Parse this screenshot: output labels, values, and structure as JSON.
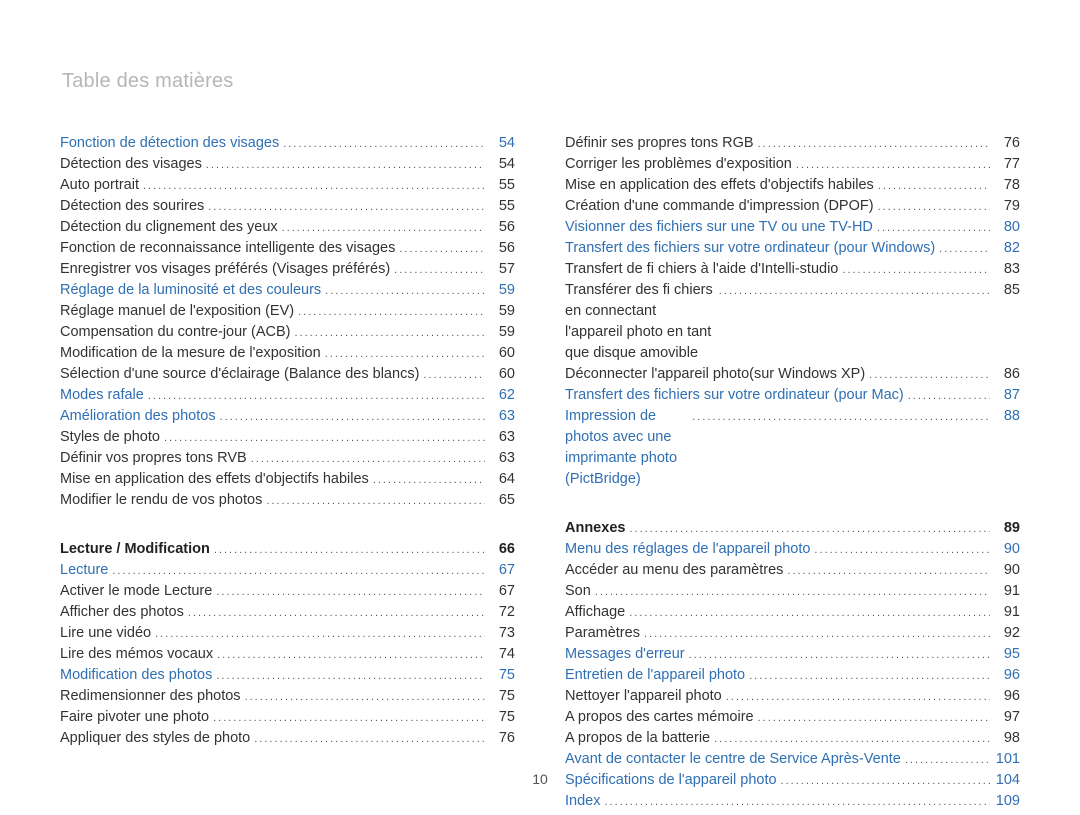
{
  "header": {
    "title": "Table des matières"
  },
  "page_number": "10",
  "columns": [
    [
      {
        "label": "Fonction de détection des visages",
        "page": "54",
        "style": "highlight"
      },
      {
        "label": "Détection des visages",
        "page": "54"
      },
      {
        "label": "Auto portrait",
        "page": "55"
      },
      {
        "label": "Détection des sourires",
        "page": "55"
      },
      {
        "label": "Détection du clignement des yeux",
        "page": "56"
      },
      {
        "label": "Fonction de reconnaissance intelligente des visages",
        "page": "56"
      },
      {
        "label": "Enregistrer vos visages préférés (Visages préférés)",
        "page": "57"
      },
      {
        "label": "Réglage de la luminosité et des couleurs",
        "page": "59",
        "style": "highlight"
      },
      {
        "label": "Réglage manuel de l'exposition (EV)",
        "page": "59"
      },
      {
        "label": "Compensation du contre-jour (ACB)",
        "page": "59"
      },
      {
        "label": "Modification de la mesure de l'exposition",
        "page": "60"
      },
      {
        "label": "Sélection d'une source d'éclairage (Balance des blancs)",
        "page": "60"
      },
      {
        "label": "Modes rafale",
        "page": "62",
        "style": "highlight"
      },
      {
        "label": "Amélioration des photos",
        "page": "63",
        "style": "highlight"
      },
      {
        "label": "Styles de photo",
        "page": "63"
      },
      {
        "label": "Définir vos propres tons RVB",
        "page": "63"
      },
      {
        "label": "Mise en application des effets d'objectifs habiles",
        "page": "64"
      },
      {
        "label": "Modifier le rendu de vos photos",
        "page": "65"
      },
      {
        "label": "Lecture / Modification",
        "page": "66",
        "style": "chapter",
        "gap": true
      },
      {
        "label": "Lecture",
        "page": "67",
        "style": "highlight"
      },
      {
        "label": "Activer le mode Lecture",
        "page": "67"
      },
      {
        "label": "Afficher des photos",
        "page": "72"
      },
      {
        "label": "Lire une vidéo",
        "page": "73"
      },
      {
        "label": "Lire des mémos vocaux",
        "page": "74"
      },
      {
        "label": "Modification des photos",
        "page": "75",
        "style": "highlight"
      },
      {
        "label": "Redimensionner des photos",
        "page": "75"
      },
      {
        "label": "Faire pivoter une photo",
        "page": "75"
      },
      {
        "label": "Appliquer des styles de photo",
        "page": "76"
      }
    ],
    [
      {
        "label": "Définir ses propres tons RGB",
        "page": "76"
      },
      {
        "label": "Corriger les problèmes d'exposition",
        "page": "77"
      },
      {
        "label": "Mise en application des effets d'objectifs habiles",
        "page": "78"
      },
      {
        "label": "Création d'une commande d'impression (DPOF)",
        "page": "79"
      },
      {
        "label": "Visionner des fichiers sur une TV ou une TV-HD",
        "page": "80",
        "style": "highlight"
      },
      {
        "label": "Transfert des fichiers sur votre ordinateur (pour Windows)",
        "page": "82",
        "style": "highlight"
      },
      {
        "label": "Transfert de fi chiers à l'aide d'Intelli-studio",
        "page": "83"
      },
      {
        "label": "Transférer des fi chiers en connectant l'appareil photo en tant que disque amovible",
        "page": "85",
        "wrap": true
      },
      {
        "label": "Déconnecter l'appareil photo(sur Windows XP)",
        "page": "86"
      },
      {
        "label": "Transfert des fichiers sur votre ordinateur (pour Mac)",
        "page": "87",
        "style": "highlight"
      },
      {
        "label": "Impression de photos avec une imprimante photo (PictBridge)",
        "page": "88",
        "style": "highlight",
        "wrap": true
      },
      {
        "label": "Annexes",
        "page": "89",
        "style": "chapter",
        "gap": true
      },
      {
        "label": "Menu des réglages de l'appareil photo",
        "page": "90",
        "style": "highlight"
      },
      {
        "label": "Accéder au menu des paramètres",
        "page": "90"
      },
      {
        "label": "Son",
        "page": "91"
      },
      {
        "label": "Affichage",
        "page": "91"
      },
      {
        "label": "Paramètres",
        "page": "92"
      },
      {
        "label": "Messages d'erreur",
        "page": "95",
        "style": "highlight"
      },
      {
        "label": "Entretien de l'appareil photo",
        "page": "96",
        "style": "highlight"
      },
      {
        "label": "Nettoyer l'appareil photo",
        "page": "96"
      },
      {
        "label": "A propos des cartes mémoire",
        "page": "97"
      },
      {
        "label": "A propos de la batterie",
        "page": "98"
      },
      {
        "label": "Avant de contacter le centre de Service Après-Vente",
        "page": "101",
        "style": "highlight"
      },
      {
        "label": "Spécifications de l'appareil photo",
        "page": "104",
        "style": "highlight"
      },
      {
        "label": "Index",
        "page": "109",
        "style": "highlight"
      }
    ]
  ]
}
